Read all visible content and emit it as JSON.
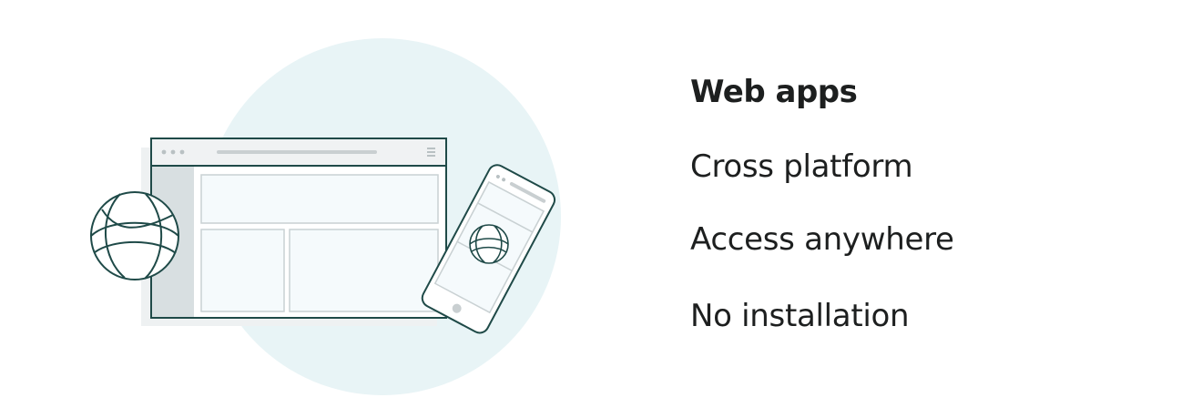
{
  "illustration": {
    "icons": [
      "browser-window-icon",
      "globe-icon",
      "smartphone-icon"
    ],
    "colors": {
      "circle_bg": "#e8f4f6",
      "outline": "#1f4a48",
      "panel_fill": "#f5fafc",
      "sidebar_fill": "#d8dfe1",
      "shadow": "#eef1f2"
    }
  },
  "features": {
    "title": "Web apps",
    "items": [
      "Cross platform",
      "Access anywhere",
      "No installation"
    ]
  }
}
